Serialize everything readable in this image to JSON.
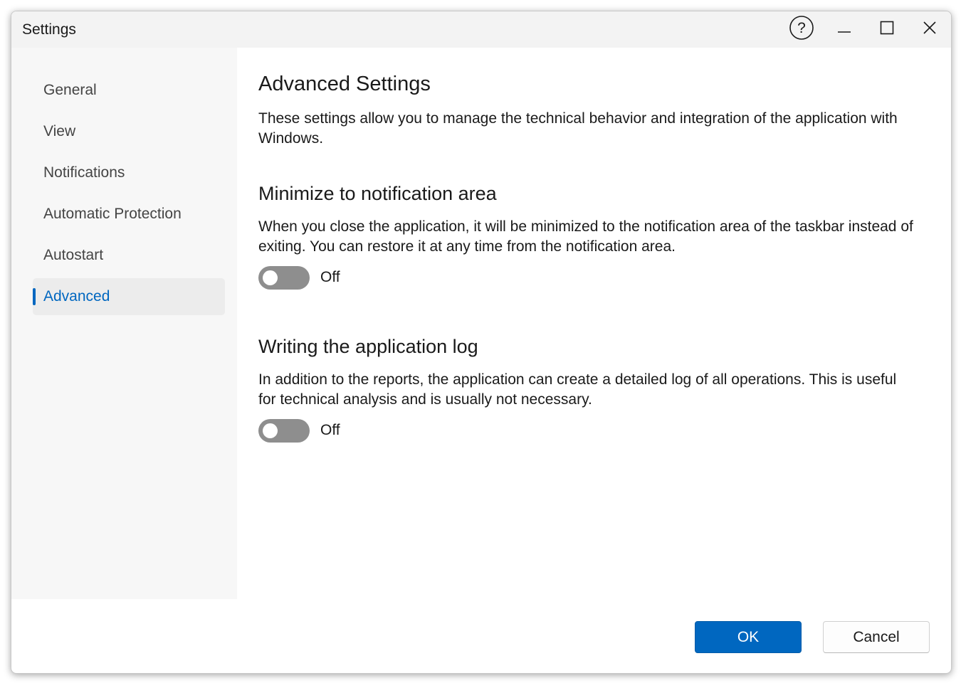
{
  "window": {
    "title": "Settings",
    "controls": {
      "help_icon": "help-icon",
      "minimize_icon": "minimize-icon",
      "maximize_icon": "maximize-icon",
      "close_icon": "close-icon"
    }
  },
  "sidebar": {
    "items": [
      {
        "label": "General",
        "active": false
      },
      {
        "label": "View",
        "active": false
      },
      {
        "label": "Notifications",
        "active": false
      },
      {
        "label": "Automatic Protection",
        "active": false
      },
      {
        "label": "Autostart",
        "active": false
      },
      {
        "label": "Advanced",
        "active": true
      }
    ]
  },
  "main": {
    "heading": "Advanced Settings",
    "description": "These settings allow you to manage the technical behavior and integration of the application with Windows.",
    "sections": [
      {
        "title": "Minimize to notification area",
        "description": "When you close the application, it will be minimized to the notification area of the taskbar instead of exiting. You can restore it at any time from the notification area.",
        "toggle_state": "Off"
      },
      {
        "title": "Writing the application log",
        "description": "In addition to the reports, the application can create a detailed log of all operations. This is useful for technical analysis and is usually not necessary.",
        "toggle_state": "Off"
      }
    ]
  },
  "footer": {
    "ok_label": "OK",
    "cancel_label": "Cancel"
  },
  "colors": {
    "accent": "#0067c0",
    "toggle_off": "#8e8e8e",
    "sidebar_bg": "#f7f7f7",
    "titlebar_bg": "#f3f3f3"
  }
}
